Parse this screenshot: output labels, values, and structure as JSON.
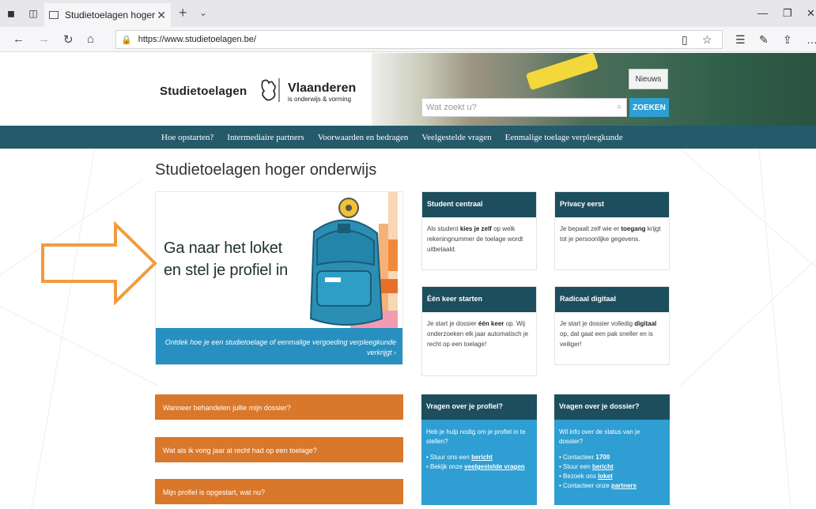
{
  "browser": {
    "tab_title": "Studietoelagen hoger o",
    "url": "https://www.studietoelagen.be/"
  },
  "header": {
    "brand": "Studietoelagen",
    "vl_name": "Vlaanderen",
    "vl_sub": "is onderwijs & vorming",
    "nieuws": "Nieuws",
    "search_placeholder": "Wat zoekt u?",
    "search_button": "ZOEKEN"
  },
  "nav": [
    "Hoe opstarten?",
    "Intermediaire partners",
    "Voorwaarden en bedragen",
    "Veelgestelde vragen",
    "Eenmalige toelage verpleegkunde"
  ],
  "main": {
    "title": "Studietoelagen hoger onderwijs",
    "loket_line1": "Ga naar het loket",
    "loket_line2": "en stel je profiel in",
    "loket_caption": "Ontdek hoe je een studietoelage of eenmalige vergoeding verpleegkunde verkrijgt ›"
  },
  "cards": {
    "c1": {
      "title": "Student centraal",
      "a": "Als student ",
      "b": "kies je zelf",
      "c": " op welk rekeningnummer de toelage wordt uitbetaald."
    },
    "c2": {
      "title": "Privacy eerst",
      "a": "Je bepaalt zelf wie er ",
      "b": "toegang",
      "c": " krijgt tot je persoonlijke gegevens."
    },
    "c3": {
      "title": "Één keer starten",
      "a": "Je start je dossier ",
      "b": "één keer",
      "c": " op. Wij onderzoeken elk jaar automatisch je recht op een toelage!"
    },
    "c4": {
      "title": "Radicaal digitaal",
      "a": "Je start je dossier volledig ",
      "b": "digitaal",
      "c": " op, dat gaat een pak sneller en is veiliger!"
    }
  },
  "faq": [
    "Wanneer behandelen jullie mijn dossier?",
    "Wat als ik vorig jaar al recht had op een toelage?",
    "Mijn profiel is opgestart, wat nu?"
  ],
  "help_profile": {
    "title": "Vragen over je profiel?",
    "intro": "Heb je hulp nodig om je profiel in te stellen?",
    "li1_a": "Stuur ons een ",
    "li1_b": "bericht",
    "li2_a": "Bekijk onze ",
    "li2_b": "veelgestelde vragen"
  },
  "help_dossier": {
    "title": "Vragen over je dossier?",
    "intro": "Wil info over de status van je dossier?",
    "li1_a": "Contacteer ",
    "li1_b": "1700",
    "li2_a": "Stuur een ",
    "li2_b": "bericht",
    "li3_a": "Bezoek ons ",
    "li3_b": "loket",
    "li4_a": "Contacteer onze ",
    "li4_b": "partners"
  }
}
